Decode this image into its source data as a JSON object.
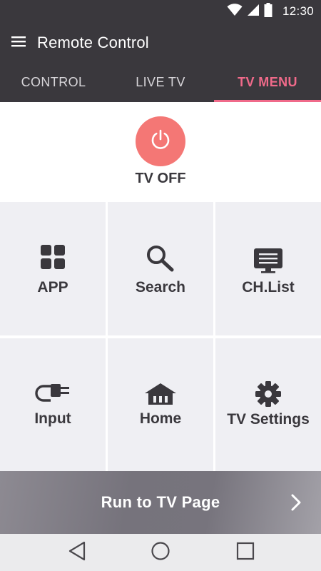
{
  "status_bar": {
    "time": "12:30",
    "icons": [
      "wifi-icon",
      "cell-signal-icon",
      "battery-icon"
    ]
  },
  "app_bar": {
    "title": "Remote Control",
    "menu_icon": "hamburger-menu-icon"
  },
  "tabs": [
    {
      "label": "CONTROL",
      "active": false
    },
    {
      "label": "LIVE TV",
      "active": false
    },
    {
      "label": "TV MENU",
      "active": true
    }
  ],
  "power": {
    "label": "TV OFF",
    "icon": "power-icon",
    "color": "#f47775"
  },
  "grid": [
    {
      "label": "APP",
      "icon": "apps-grid-icon"
    },
    {
      "label": "Search",
      "icon": "search-icon"
    },
    {
      "label": "CH.List",
      "icon": "channel-list-icon"
    },
    {
      "label": "Input",
      "icon": "input-plug-icon"
    },
    {
      "label": "Home",
      "icon": "home-icon"
    },
    {
      "label": "TV Settings",
      "icon": "gear-icon"
    }
  ],
  "run_to_tv": {
    "label": "Run to TV Page",
    "icon": "chevron-right-icon"
  },
  "nav_bar": {
    "icons": [
      "back-icon",
      "home-circle-icon",
      "recents-icon"
    ]
  },
  "colors": {
    "header": "#3a383d",
    "accent": "#f06a8a",
    "power": "#f47775",
    "tile": "#efeff3",
    "text_dark": "#3a383d"
  }
}
